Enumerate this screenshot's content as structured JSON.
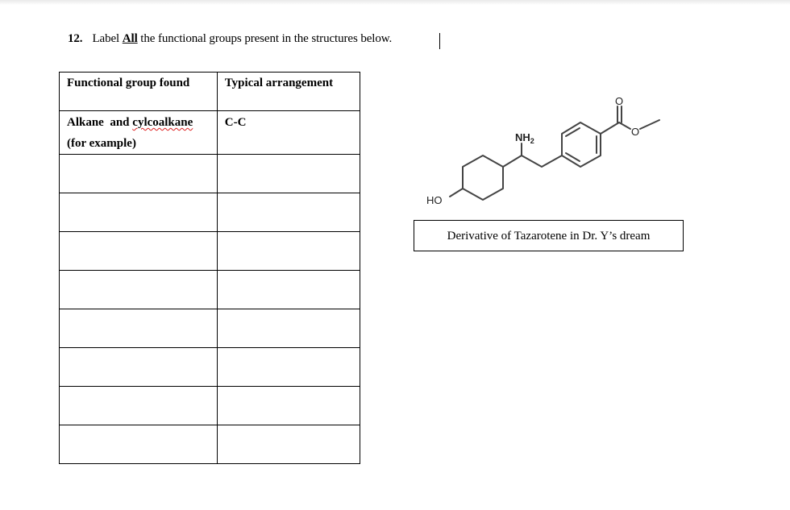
{
  "question": {
    "number": "12.",
    "prefix": "Label",
    "emphasis": "All",
    "suffix": "the functional groups present in the structures below."
  },
  "table": {
    "headers": [
      "Functional group found",
      "Typical arrangement"
    ],
    "example_row": {
      "group_line1_a": "Alkane  and ",
      "group_line1_misspelled": "cylcoalkane",
      "group_line2": "(for example)",
      "arrangement": "C-C"
    },
    "empty_rows": [
      {
        "group": "",
        "arrangement": ""
      },
      {
        "group": "",
        "arrangement": ""
      },
      {
        "group": "",
        "arrangement": ""
      },
      {
        "group": "",
        "arrangement": ""
      },
      {
        "group": "",
        "arrangement": ""
      },
      {
        "group": "",
        "arrangement": ""
      },
      {
        "group": "",
        "arrangement": ""
      },
      {
        "group": "",
        "arrangement": ""
      }
    ]
  },
  "structure": {
    "labels": {
      "hydroxyl": "HO",
      "amine": "NH",
      "amine_sub": "2",
      "carbonyl_o": "O",
      "ester_o": "O"
    },
    "caption": "Derivative of Tazarotene in Dr. Y’s dream"
  }
}
